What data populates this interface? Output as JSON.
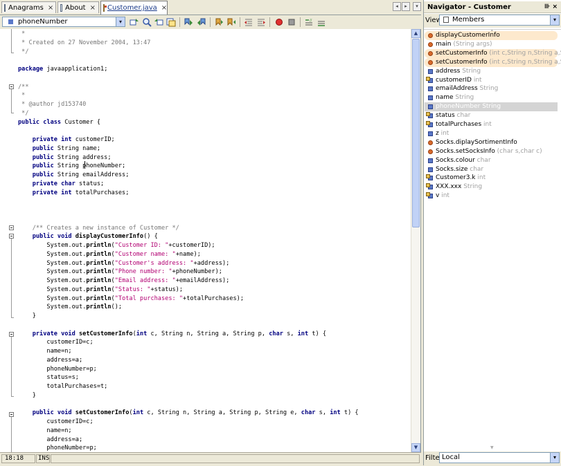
{
  "editor": {
    "tabs": [
      {
        "label": "Anagrams",
        "close": "×",
        "icon": "form-icon"
      },
      {
        "label": "About",
        "close": "×",
        "icon": "form-icon"
      },
      {
        "label": "Customer.java",
        "close": "×",
        "icon": "java-file-icon"
      }
    ],
    "tab_nav": {
      "left": "◂",
      "right": "▸",
      "menu": "▾"
    },
    "member_combo": {
      "value": "phoneNumber",
      "arrow": "▾"
    },
    "code_lines": [
      [
        {
          "t": " *",
          "c": "cm"
        }
      ],
      [
        {
          "t": " * Created on 27 November 2004, 13:47",
          "c": "cm"
        }
      ],
      [
        {
          "t": " */",
          "c": "cm"
        }
      ],
      [],
      [
        {
          "t": "package ",
          "c": "kw"
        },
        {
          "t": "javaapplication1;",
          "c": ""
        }
      ],
      [],
      [
        {
          "t": "/**",
          "c": "cm"
        }
      ],
      [
        {
          "t": " *",
          "c": "cm"
        }
      ],
      [
        {
          "t": " * @author jd153740",
          "c": "cm"
        }
      ],
      [
        {
          "t": " */",
          "c": "cm"
        }
      ],
      [
        {
          "t": "public class ",
          "c": "kw"
        },
        {
          "t": "Customer {",
          "c": ""
        }
      ],
      [],
      [
        {
          "t": "    private int ",
          "c": "kw"
        },
        {
          "t": "customerID;",
          "c": ""
        }
      ],
      [
        {
          "t": "    public ",
          "c": "kw"
        },
        {
          "t": "String name;",
          "c": ""
        }
      ],
      [
        {
          "t": "    public ",
          "c": "kw"
        },
        {
          "t": "String address;",
          "c": ""
        }
      ],
      [
        {
          "t": "    public ",
          "c": "kw"
        },
        {
          "t": "String phoneNumber;",
          "c": ""
        }
      ],
      [
        {
          "t": "    public ",
          "c": "kw"
        },
        {
          "t": "String emailAddress;",
          "c": ""
        }
      ],
      [
        {
          "t": "    private char ",
          "c": "kw"
        },
        {
          "t": "status;",
          "c": ""
        }
      ],
      [
        {
          "t": "    private int ",
          "c": "kw"
        },
        {
          "t": "totalPurchases;",
          "c": ""
        }
      ],
      [],
      [],
      [],
      [
        {
          "t": "    /** Creates a new instance of Customer */",
          "c": "cm"
        }
      ],
      [
        {
          "t": "    public void ",
          "c": "kw"
        },
        {
          "t": "displayCustomerInfo",
          "c": "mt"
        },
        {
          "t": "() {",
          "c": ""
        }
      ],
      [
        {
          "t": "        System.out.",
          "c": ""
        },
        {
          "t": "println",
          "c": "mt"
        },
        {
          "t": "(",
          "c": ""
        },
        {
          "t": "\"Customer ID: \"",
          "c": "st"
        },
        {
          "t": "+customerID);",
          "c": ""
        }
      ],
      [
        {
          "t": "        System.out.",
          "c": ""
        },
        {
          "t": "println",
          "c": "mt"
        },
        {
          "t": "(",
          "c": ""
        },
        {
          "t": "\"Customer name: \"",
          "c": "st"
        },
        {
          "t": "+name);",
          "c": ""
        }
      ],
      [
        {
          "t": "        System.out.",
          "c": ""
        },
        {
          "t": "println",
          "c": "mt"
        },
        {
          "t": "(",
          "c": ""
        },
        {
          "t": "\"Customer's address: \"",
          "c": "st"
        },
        {
          "t": "+address);",
          "c": ""
        }
      ],
      [
        {
          "t": "        System.out.",
          "c": ""
        },
        {
          "t": "println",
          "c": "mt"
        },
        {
          "t": "(",
          "c": ""
        },
        {
          "t": "\"Phone number: \"",
          "c": "st"
        },
        {
          "t": "+phoneNumber);",
          "c": ""
        }
      ],
      [
        {
          "t": "        System.out.",
          "c": ""
        },
        {
          "t": "println",
          "c": "mt"
        },
        {
          "t": "(",
          "c": ""
        },
        {
          "t": "\"Email address: \"",
          "c": "st"
        },
        {
          "t": "+emailAddress);",
          "c": ""
        }
      ],
      [
        {
          "t": "        System.out.",
          "c": ""
        },
        {
          "t": "println",
          "c": "mt"
        },
        {
          "t": "(",
          "c": ""
        },
        {
          "t": "\"Status: \"",
          "c": "st"
        },
        {
          "t": "+status);",
          "c": ""
        }
      ],
      [
        {
          "t": "        System.out.",
          "c": ""
        },
        {
          "t": "println",
          "c": "mt"
        },
        {
          "t": "(",
          "c": ""
        },
        {
          "t": "\"Total purchases: \"",
          "c": "st"
        },
        {
          "t": "+totalPurchases);",
          "c": ""
        }
      ],
      [
        {
          "t": "        System.out.",
          "c": ""
        },
        {
          "t": "println",
          "c": "mt"
        },
        {
          "t": "();",
          "c": ""
        }
      ],
      [
        {
          "t": "    }",
          "c": ""
        }
      ],
      [],
      [
        {
          "t": "    private void ",
          "c": "kw"
        },
        {
          "t": "setCustomerInfo",
          "c": "mt"
        },
        {
          "t": "(",
          "c": ""
        },
        {
          "t": "int ",
          "c": "kw"
        },
        {
          "t": "c, String n, String a, String p, ",
          "c": ""
        },
        {
          "t": "char ",
          "c": "kw"
        },
        {
          "t": "s, ",
          "c": ""
        },
        {
          "t": "int ",
          "c": "kw"
        },
        {
          "t": "t) {",
          "c": ""
        }
      ],
      [
        {
          "t": "        customerID=c;",
          "c": ""
        }
      ],
      [
        {
          "t": "        name=n;",
          "c": ""
        }
      ],
      [
        {
          "t": "        address=a;",
          "c": ""
        }
      ],
      [
        {
          "t": "        phoneNumber=p;",
          "c": ""
        }
      ],
      [
        {
          "t": "        status=s;",
          "c": ""
        }
      ],
      [
        {
          "t": "        totalPurchases=t;",
          "c": ""
        }
      ],
      [
        {
          "t": "    }",
          "c": ""
        }
      ],
      [],
      [
        {
          "t": "    public void ",
          "c": "kw"
        },
        {
          "t": "setCustomerInfo",
          "c": "mt"
        },
        {
          "t": "(",
          "c": ""
        },
        {
          "t": "int ",
          "c": "kw"
        },
        {
          "t": "c, String n, String a, String p, String e, ",
          "c": ""
        },
        {
          "t": "char ",
          "c": "kw"
        },
        {
          "t": "s, ",
          "c": ""
        },
        {
          "t": "int ",
          "c": "kw"
        },
        {
          "t": "t) {",
          "c": ""
        }
      ],
      [
        {
          "t": "        customerID=c;",
          "c": ""
        }
      ],
      [
        {
          "t": "        name=n;",
          "c": ""
        }
      ],
      [
        {
          "t": "        address=a;",
          "c": ""
        }
      ],
      [
        {
          "t": "        phoneNumber=p;",
          "c": ""
        }
      ]
    ],
    "status": {
      "position": "18:18",
      "mode": "INS"
    }
  },
  "navigator": {
    "title": "Navigator - Customer",
    "title_buttons": "⊪ ×",
    "view_label": "View",
    "view_value": "Members",
    "filter_label": "Filter",
    "filter_value": "Local",
    "combo_arrow": "▾",
    "members": [
      {
        "name": "displayCustomerInfo",
        "type": "",
        "kind": "method",
        "state": "hl"
      },
      {
        "name": "main",
        "type": "(String args)",
        "kind": "method",
        "state": ""
      },
      {
        "name": "setCustomerInfo",
        "type": "(int c,String n,String a,String p,char s,int t)",
        "kind": "method",
        "state": "hl"
      },
      {
        "name": "setCustomerInfo",
        "type": "(int c,String n,String a,String p,String e,char s,int t)",
        "kind": "method",
        "state": "hl"
      },
      {
        "name": "address",
        "type": "String",
        "kind": "field",
        "state": ""
      },
      {
        "name": "customerID",
        "type": "int",
        "kind": "field2",
        "state": ""
      },
      {
        "name": "emailAddress",
        "type": "String",
        "kind": "field",
        "state": ""
      },
      {
        "name": "name",
        "type": "String",
        "kind": "field",
        "state": ""
      },
      {
        "name": "phoneNumber",
        "type": "String",
        "kind": "field",
        "state": "sel"
      },
      {
        "name": "status",
        "type": "char",
        "kind": "field2",
        "state": ""
      },
      {
        "name": "totalPurchases",
        "type": "int",
        "kind": "field2",
        "state": ""
      },
      {
        "name": "z",
        "type": "int",
        "kind": "field",
        "state": ""
      },
      {
        "name": "Socks.diplaySortimentInfo",
        "type": "",
        "kind": "method",
        "state": ""
      },
      {
        "name": "Socks.setSocksInfo",
        "type": "(char s,char c)",
        "kind": "method",
        "state": ""
      },
      {
        "name": "Socks.colour",
        "type": "char",
        "kind": "field",
        "state": ""
      },
      {
        "name": "Socks.size",
        "type": "char",
        "kind": "field",
        "state": ""
      },
      {
        "name": "Customer3.k",
        "type": "int",
        "kind": "field2",
        "state": ""
      },
      {
        "name": "XXX.xxx",
        "type": "String",
        "kind": "field2",
        "state": ""
      },
      {
        "name": "v",
        "type": "int",
        "kind": "field2",
        "state": ""
      }
    ]
  }
}
